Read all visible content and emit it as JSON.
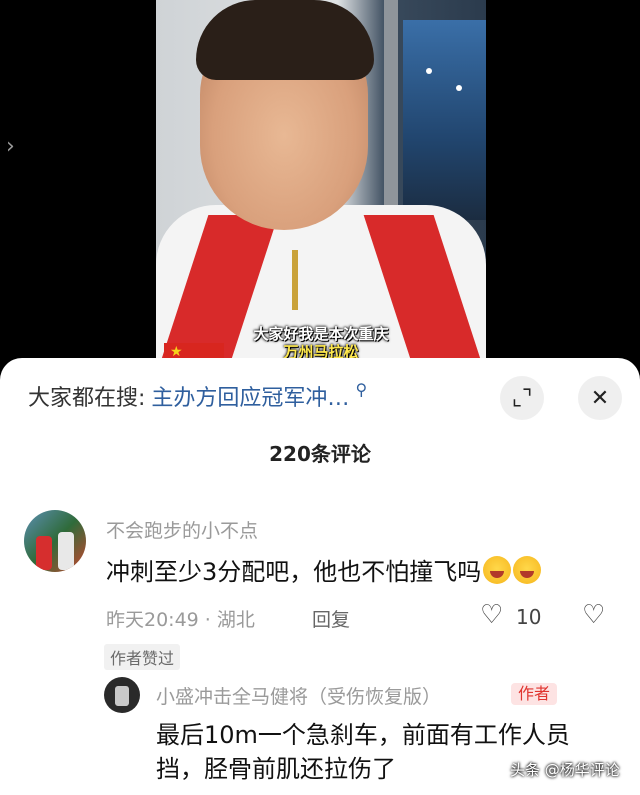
{
  "video": {
    "subtitle_line1": "大家好我是本次重庆",
    "subtitle_line2": "万州马拉松"
  },
  "panel": {
    "search_prefix": "大家都在搜:",
    "search_term": "主办方回应冠军冲…",
    "comment_count": "220条评论"
  },
  "comment": {
    "username": "不会跑步的小不点",
    "text": "冲刺至少3分配吧，他也不怕撞飞吗",
    "meta": "昨天20:49 · 湖北",
    "reply_label": "回复",
    "like_count": "10",
    "author_liked": "作者赞过"
  },
  "reply": {
    "username": "小盛冲击全马健将（受伤恢复版）",
    "badge": "作者",
    "text": "最后10m一个急刹车，前面有工作人员挡，胫骨前肌还拉伤了"
  },
  "watermark": "头条 @杨华评论"
}
